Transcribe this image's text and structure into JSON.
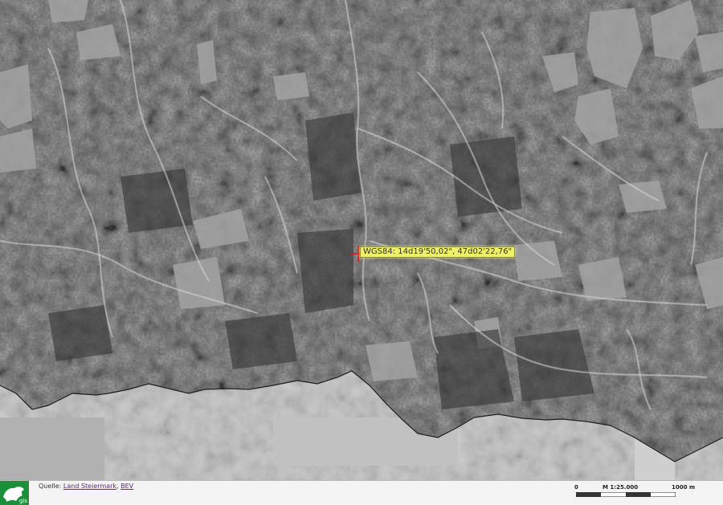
{
  "map": {
    "coordinate_label": "WGS84: 14d19'50,02\", 47d02'22,76\"",
    "crosshair_icon": "crosshair-icon"
  },
  "footer": {
    "logo_icon": "styria-panther-logo-icon",
    "logo_text": "gis",
    "source_prefix": "Quelle:",
    "source_link_1": "Land Steiermark",
    "source_separator": ",",
    "source_link_2": "BEV"
  },
  "scalebar": {
    "start_label": "0",
    "scale_label": "M 1:25.000",
    "end_label": "1000 m"
  },
  "colors": {
    "label_background": "#eef06a",
    "crosshair": "#e01010",
    "link": "#5c2a7c"
  }
}
